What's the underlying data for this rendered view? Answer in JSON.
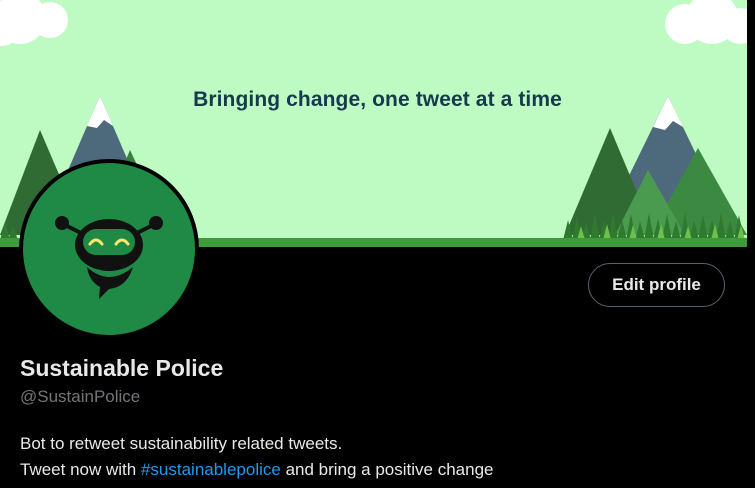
{
  "banner": {
    "tagline": "Bringing change, one tweet at a time",
    "background_color": "#bdfbc3"
  },
  "profile": {
    "display_name": "Sustainable Police",
    "handle": "@SustainPolice",
    "avatar_icon": "robot-chat-icon",
    "avatar_color": "#1e8a45",
    "bio_line1": "Bot to retweet sustainability related tweets.",
    "bio_line2_before": "Tweet now with ",
    "bio_hashtag": "#sustainablepolice",
    "bio_line2_after": " and bring a positive change"
  },
  "actions": {
    "edit_profile_label": "Edit profile"
  },
  "colors": {
    "accent": "#1d9bf0",
    "text_primary": "#e7e9ea",
    "text_secondary": "#71767b"
  }
}
